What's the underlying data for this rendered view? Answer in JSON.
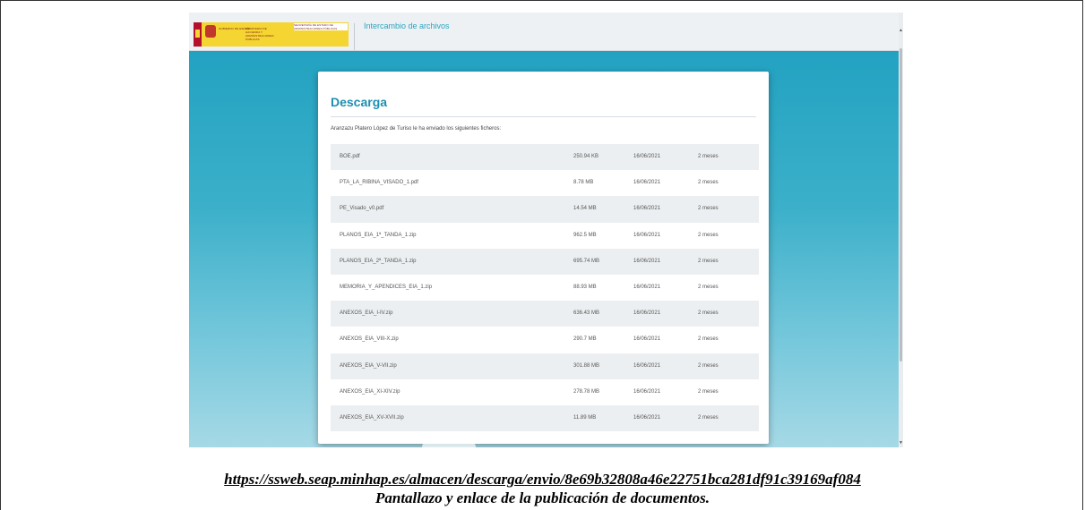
{
  "header": {
    "logo_text_1": "GOBIERNO DE ESPAÑA",
    "logo_text_2": "MINISTERIO DE HACIENDA Y ADMINISTRACIONES PUBLICAS",
    "logo_text_3": "SECRETARÍA DE ESTADO DE ADMINISTRACIONES PÚBLICAS",
    "app_title": "Intercambio de archivos"
  },
  "card": {
    "title": "Descarga",
    "intro": "Aranzazu Platero López de Turiso le ha enviado los siguientes ficheros:"
  },
  "files": [
    {
      "name": "BOE.pdf",
      "size": "250.94 KB",
      "date": "16/06/2021",
      "expires": "2 meses"
    },
    {
      "name": "PTA_LA_RIBINA_VISADO_1.pdf",
      "size": "8.78 MB",
      "date": "16/06/2021",
      "expires": "2 meses"
    },
    {
      "name": "PE_Visado_v0.pdf",
      "size": "14.54 MB",
      "date": "16/06/2021",
      "expires": "2 meses"
    },
    {
      "name": "PLANOS_EIA_1ª_TANDA_1.zip",
      "size": "962.5 MB",
      "date": "16/06/2021",
      "expires": "2 meses"
    },
    {
      "name": "PLANOS_EIA_2ª_TANDA_1.zip",
      "size": "695.74 MB",
      "date": "16/06/2021",
      "expires": "2 meses"
    },
    {
      "name": "MEMORIA_Y_APENDICES_EIA_1.zip",
      "size": "88.93 MB",
      "date": "16/06/2021",
      "expires": "2 meses"
    },
    {
      "name": "ANEXOS_EIA_I-IV.zip",
      "size": "636.43 MB",
      "date": "16/06/2021",
      "expires": "2 meses"
    },
    {
      "name": "ANEXOS_EIA_VIII-X.zip",
      "size": "290.7 MB",
      "date": "16/06/2021",
      "expires": "2 meses"
    },
    {
      "name": "ANEXOS_EIA_V-VII.zip",
      "size": "301.88 MB",
      "date": "16/06/2021",
      "expires": "2 meses"
    },
    {
      "name": "ANEXOS_EIA_XI-XIV.zip",
      "size": "278.78 MB",
      "date": "16/06/2021",
      "expires": "2 meses"
    },
    {
      "name": "ANEXOS_EIA_XV-XVII.zip",
      "size": "11.89 MB",
      "date": "16/06/2021",
      "expires": "2 meses"
    }
  ],
  "footer": {
    "url": "https://ssweb.seap.minhap.es/almacen/descarga/envio/8e69b32808a46e22751bca281df91c39169af084",
    "caption": "Pantallazo y enlace de la publicación de documentos."
  },
  "icons": {
    "scroll_up": "triangle-up",
    "scroll_down": "triangle-down"
  }
}
